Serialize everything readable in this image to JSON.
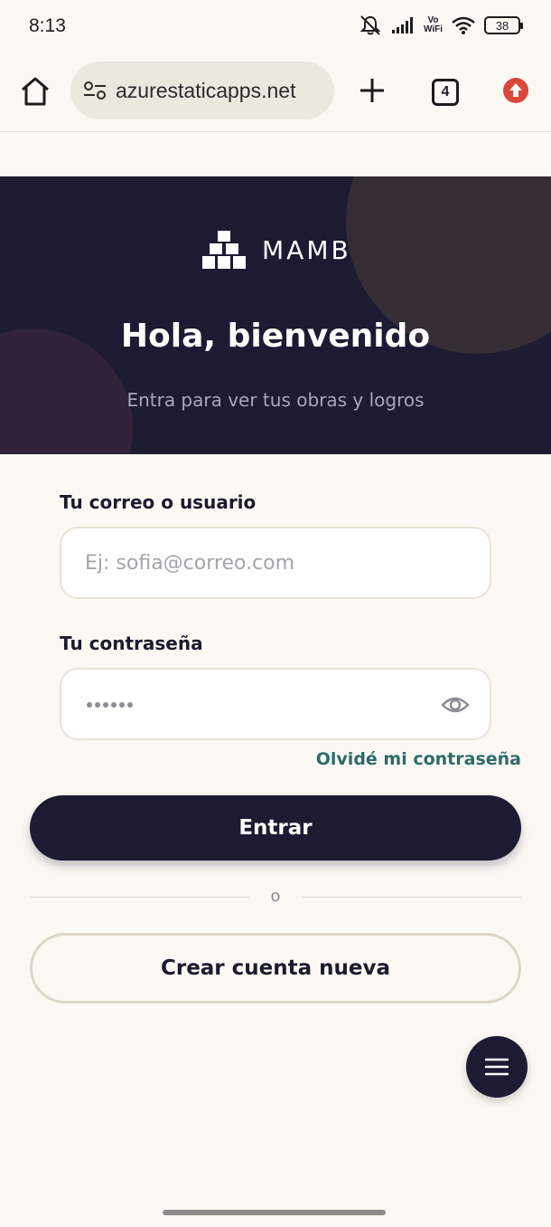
{
  "status_bar": {
    "time": "8:13",
    "vowifi_line1": "Vo",
    "vowifi_line2": "WiFi",
    "battery": "38"
  },
  "browser": {
    "url": "azurestaticapps.net",
    "tab_count": "4",
    "accent_color": "#d9483b"
  },
  "hero": {
    "logo_text": "MAMB",
    "title": "Hola, bienvenido",
    "subtitle": "Entra para ver tus obras y logros"
  },
  "form": {
    "email_label": "Tu correo o usuario",
    "email_placeholder": "Ej: sofia@correo.com",
    "password_label": "Tu contraseña",
    "password_dot_count": 6,
    "forgot_link": "Olvidé mi contraseña",
    "submit_label": "Entrar",
    "divider_text": "o",
    "create_account_label": "Crear cuenta nueva"
  },
  "icons": {
    "home": "home-icon",
    "site_settings": "site-settings-icon",
    "new_tab": "plus-icon",
    "update": "arrow-up-icon",
    "show_password": "eye-icon",
    "menu": "hamburger-menu-icon",
    "logo": "building-blocks-icon"
  },
  "colors": {
    "primary": "#1c1b32",
    "link": "#2d6b6b",
    "background": "#fcf9f4"
  }
}
